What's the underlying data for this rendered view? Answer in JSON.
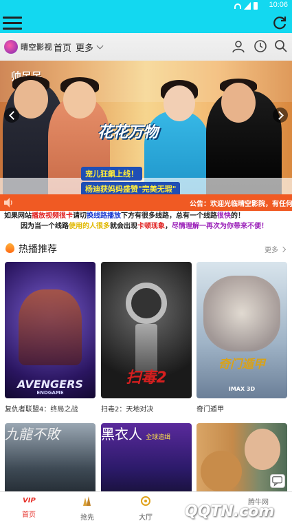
{
  "status_bar": {
    "time": "10:06"
  },
  "nav": {
    "logo_text": "晴空影视",
    "home_label": "首页",
    "more_label": "更多"
  },
  "banner": {
    "show_logo": "帅呆呆",
    "title": "花花万物",
    "caption_line1": "宠儿狂飙上线！",
    "caption_line2": "杨迪获妈妈盛赞\"完美无瑕\""
  },
  "notice": {
    "text": "公告：欢迎光临晴空影院，有任何"
  },
  "tips": {
    "line1": [
      {
        "t": "如果网站",
        "c": "blk"
      },
      {
        "t": "播放视频很卡",
        "c": "red"
      },
      {
        "t": "请切",
        "c": "blk"
      },
      {
        "t": "换线路播放",
        "c": "blu"
      },
      {
        "t": "下方有很多线路，总有一个线路",
        "c": "blk"
      },
      {
        "t": "很快",
        "c": "pur"
      },
      {
        "t": "的！",
        "c": "blk"
      }
    ],
    "line2": [
      {
        "t": "因为当一个线路",
        "c": "blk"
      },
      {
        "t": "使用的人很多",
        "c": "yel"
      },
      {
        "t": "就会出现",
        "c": "blk"
      },
      {
        "t": "卡顿现象",
        "c": "red"
      },
      {
        "t": "，",
        "c": "blk"
      },
      {
        "t": "尽情理解一再次为你带来不便！",
        "c": "pur"
      }
    ]
  },
  "section": {
    "title": "热播推荐",
    "more_label": "更多"
  },
  "movies": [
    {
      "title": "复仇者联盟4：终局之战",
      "poster_text": "AVENGERS",
      "poster_sub": "ENDGAME"
    },
    {
      "title": "扫毒2：天地对决",
      "poster_text": "扫毒2",
      "poster_sub": ""
    },
    {
      "title": "奇门遁甲",
      "poster_text": "奇门遁甲",
      "poster_sub": "IMAX 3D"
    }
  ],
  "movies_row2": [
    {
      "poster_text": "九龍不敗"
    },
    {
      "poster_text": "黑衣人",
      "poster_sub": "全球追缉"
    },
    {
      "poster_text": ""
    }
  ],
  "tabs": [
    {
      "label": "首页",
      "icon_text": "VIP"
    },
    {
      "label": "抢先",
      "icon_text": ""
    },
    {
      "label": "大厅",
      "icon_text": ""
    }
  ],
  "watermark": {
    "small": "腾牛网",
    "big": "QQTN.com"
  },
  "colors": {
    "accent": "#13d8f0",
    "notice": "#f05a23",
    "active_tab": "#e6322b"
  }
}
